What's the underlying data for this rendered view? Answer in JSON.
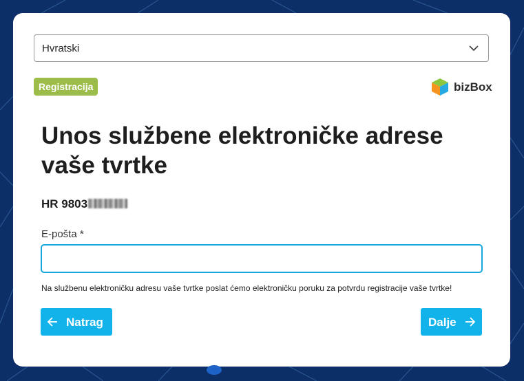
{
  "language_select": {
    "value": "Hvratski"
  },
  "badge": {
    "label": "Registracija"
  },
  "brand": {
    "name": "bizBox"
  },
  "heading": {
    "title": "Unos službene elektroničke adrese vaše tvrtke"
  },
  "company": {
    "oib_prefix": "HR 9803"
  },
  "email": {
    "label": "E-pošta *",
    "value": ""
  },
  "help_text": "Na službenu elektroničku adresu vaše tvrtke poslat ćemo elektroničku poruku za potvrdu registracije vaše tvrtke!",
  "buttons": {
    "back_label": "Natrag",
    "next_label": "Dalje"
  },
  "colors": {
    "background": "#0b2f66",
    "accent": "#12b3ea",
    "badge": "#9dbd4a",
    "input_focus": "#16a6de"
  },
  "icons": {
    "select": "chevron-down-icon",
    "back": "arrow-left-icon",
    "next": "arrow-right-icon",
    "brand": "cube-logo-icon"
  }
}
